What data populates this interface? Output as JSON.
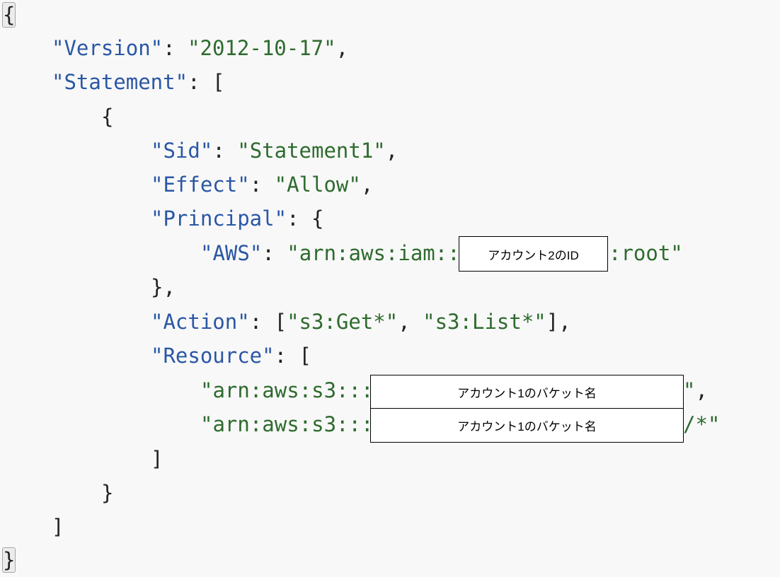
{
  "code": {
    "line1": {
      "open": "{"
    },
    "line2": {
      "key": "\"Version\"",
      "sep": ": ",
      "value": "\"2012-10-17\"",
      "tail": ","
    },
    "line3": {
      "key": "\"Statement\"",
      "sep": ": ["
    },
    "line4": {
      "open": "{"
    },
    "line5": {
      "key": "\"Sid\"",
      "sep": ": ",
      "value": "\"Statement1\"",
      "tail": ","
    },
    "line6": {
      "key": "\"Effect\"",
      "sep": ": ",
      "value": "\"Allow\"",
      "tail": ","
    },
    "line7": {
      "key": "\"Principal\"",
      "sep": ": {"
    },
    "line8": {
      "key": "\"AWS\"",
      "sep": ": ",
      "value_prefix": "\"arn:aws:iam::",
      "value_suffix": ":root\""
    },
    "line9": {
      "close": "},"
    },
    "line10": {
      "key": "\"Action\"",
      "sep": ": [",
      "v1": "\"s3:Get*\"",
      "comma": ", ",
      "v2": "\"s3:List*\"",
      "tail": "],"
    },
    "line11": {
      "key": "\"Resource\"",
      "sep": ": ["
    },
    "line12": {
      "value_prefix": "\"arn:aws:s3:::",
      "value_suffix": "\"",
      "tail": ","
    },
    "line13": {
      "value_prefix": "\"arn:aws:s3:::",
      "value_suffix": "/*\""
    },
    "line14": {
      "close": "]"
    },
    "line15": {
      "close": "}"
    },
    "line16": {
      "close": "]"
    },
    "line17": {
      "close": "}"
    }
  },
  "placeholders": {
    "account2_id": "アカウント2のID",
    "bucket_name_1": "アカウント1のバケット名",
    "bucket_name_2": "アカウント1のバケット名"
  }
}
